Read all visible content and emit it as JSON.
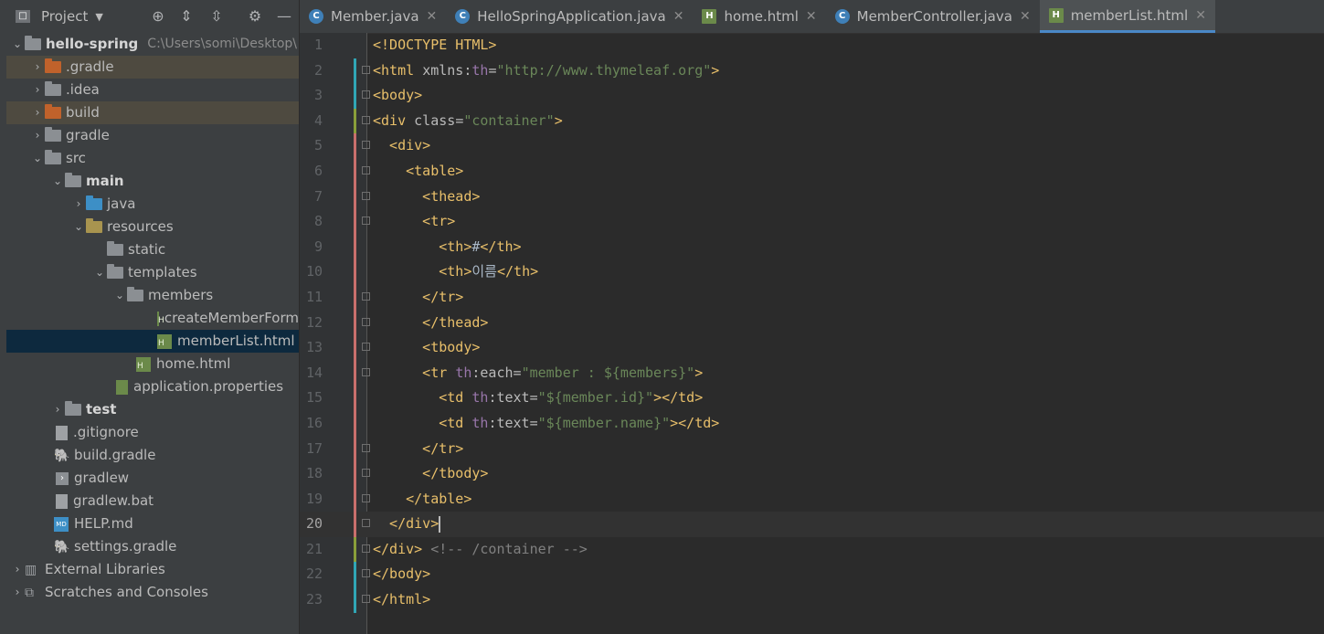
{
  "project_panel": {
    "title": "Project",
    "tree": [
      {
        "label": "hello-spring",
        "path": "C:\\Users\\somi\\Desktop\\",
        "bold": true
      },
      {
        "label": ".gradle"
      },
      {
        "label": ".idea"
      },
      {
        "label": "build"
      },
      {
        "label": "gradle"
      },
      {
        "label": "src"
      },
      {
        "label": "main",
        "bold": true
      },
      {
        "label": "java"
      },
      {
        "label": "resources"
      },
      {
        "label": "static"
      },
      {
        "label": "templates"
      },
      {
        "label": "members"
      },
      {
        "label": "createMemberForm"
      },
      {
        "label": "memberList.html"
      },
      {
        "label": "home.html"
      },
      {
        "label": "application.properties"
      },
      {
        "label": "test",
        "bold": true
      },
      {
        "label": ".gitignore"
      },
      {
        "label": "build.gradle"
      },
      {
        "label": "gradlew"
      },
      {
        "label": "gradlew.bat"
      },
      {
        "label": "HELP.md"
      },
      {
        "label": "settings.gradle"
      },
      {
        "label": "External Libraries"
      },
      {
        "label": "Scratches and Consoles"
      }
    ]
  },
  "tabs": [
    {
      "label": "Member.java",
      "icon": "c"
    },
    {
      "label": "HelloSpringApplication.java",
      "icon": "c"
    },
    {
      "label": "home.html",
      "icon": "h"
    },
    {
      "label": "MemberController.java",
      "icon": "c"
    },
    {
      "label": "memberList.html",
      "icon": "h",
      "active": true
    }
  ],
  "line_numbers": [
    "1",
    "2",
    "3",
    "4",
    "5",
    "6",
    "7",
    "8",
    "9",
    "10",
    "11",
    "12",
    "13",
    "14",
    "15",
    "16",
    "17",
    "18",
    "19",
    "20",
    "21",
    "22",
    "23"
  ],
  "code": {
    "l1": "<!DOCTYPE HTML>",
    "l2a": "<html ",
    "l2b": "xmlns:",
    "l2c": "th",
    "l2d": "=",
    "l2e": "\"http://www.thymeleaf.org\"",
    "l2f": ">",
    "l3": "<body>",
    "l4a": "<div ",
    "l4b": "class",
    "l4c": "=",
    "l4d": "\"container\"",
    "l4e": ">",
    "l5": "  <div>",
    "l6": "    <table>",
    "l7": "      <thead>",
    "l8": "      <tr>",
    "l9a": "        <th>",
    "l9b": "#",
    "l9c": "</th>",
    "l10a": "        <th>",
    "l10b": "이름",
    "l10c": "</th>",
    "l11": "      </tr>",
    "l12": "      </thead>",
    "l13": "      <tbody>",
    "l14a": "      <tr ",
    "l14b": "th",
    "l14c": ":each",
    "l14d": "=",
    "l14e": "\"member : ${members}\"",
    "l14f": ">",
    "l15a": "        <td ",
    "l15b": "th",
    "l15c": ":text",
    "l15d": "=",
    "l15e": "\"${member.id}\"",
    "l15f": "></td>",
    "l16a": "        <td ",
    "l16b": "th",
    "l16c": ":text",
    "l16d": "=",
    "l16e": "\"${member.name}\"",
    "l16f": "></td>",
    "l17": "      </tr>",
    "l18": "      </tbody>",
    "l19": "    </table>",
    "l20": "  </div>",
    "l21a": "</div> ",
    "l21b": "<!-- /container -->",
    "l22": "</body>",
    "l23": "</html>"
  }
}
